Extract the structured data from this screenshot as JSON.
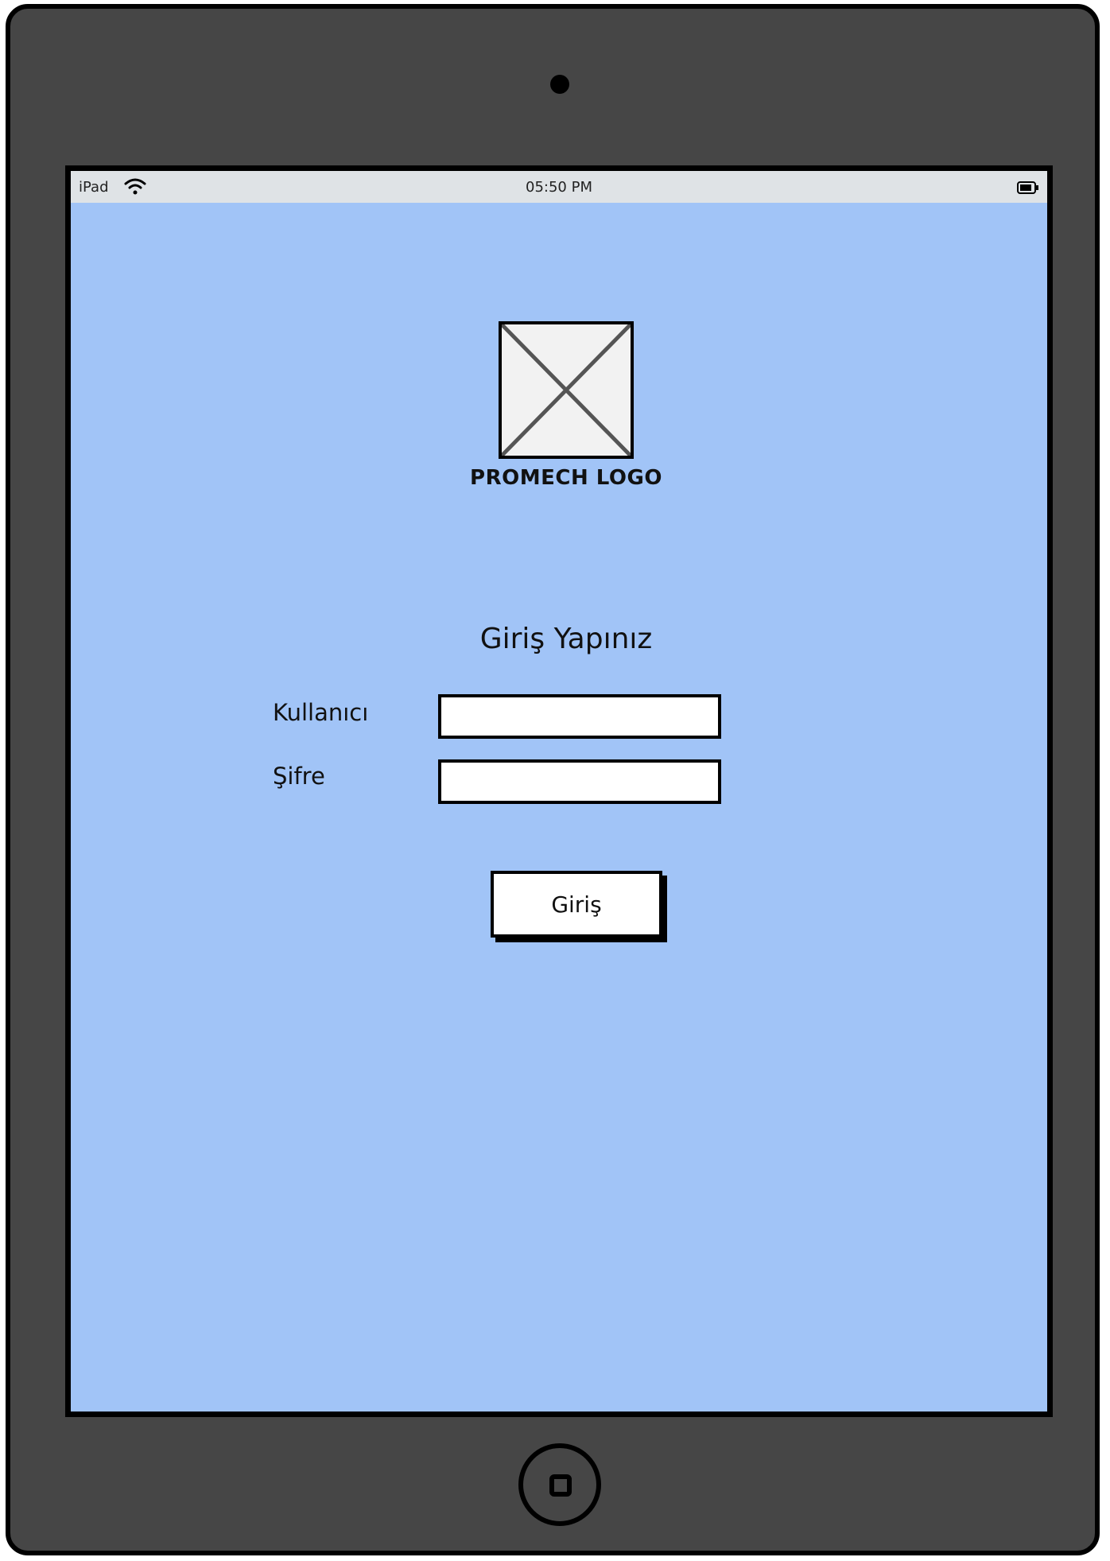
{
  "status_bar": {
    "device": "iPad",
    "time": "05:50 PM",
    "icons": [
      "wifi-icon",
      "battery-icon"
    ]
  },
  "logo": {
    "placeholder_icon": "image-placeholder-icon",
    "label": "PROMECH LOGO"
  },
  "login": {
    "title": "Giriş Yapınız",
    "username_label": "Kullanıcı",
    "username_value": "",
    "password_label": "Şifre",
    "password_value": "",
    "submit_label": "Giriş"
  },
  "device": {
    "home_button_icon": "home-button-icon",
    "colors": {
      "frame": "#464646",
      "screen": "#a1c4f7",
      "status_bar": "#dfe3e6"
    }
  }
}
